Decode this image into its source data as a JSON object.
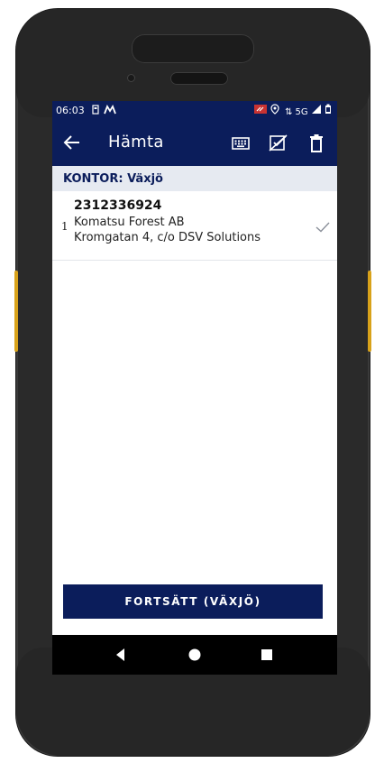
{
  "status": {
    "time": "06:03",
    "network": "5G"
  },
  "appbar": {
    "title": "Hämta"
  },
  "section": {
    "label": "KONTOR: Växjö"
  },
  "items": [
    {
      "index": "1",
      "id": "2312336924",
      "company": "Komatsu Forest AB",
      "address": "Kromgatan 4, c/o DSV Solutions"
    }
  ],
  "actions": {
    "continue_label": "FORTSÄTT (VÄXJÖ)"
  },
  "colors": {
    "primary": "#0b1d5b",
    "section_bg": "#e6eaf1",
    "accent_side": "#d8a21a"
  },
  "icons": {
    "back": "arrow-left-icon",
    "keyboard": "keyboard-icon",
    "nocheck": "uncheck-icon",
    "trash": "trash-icon",
    "checkmark": "check-icon"
  }
}
